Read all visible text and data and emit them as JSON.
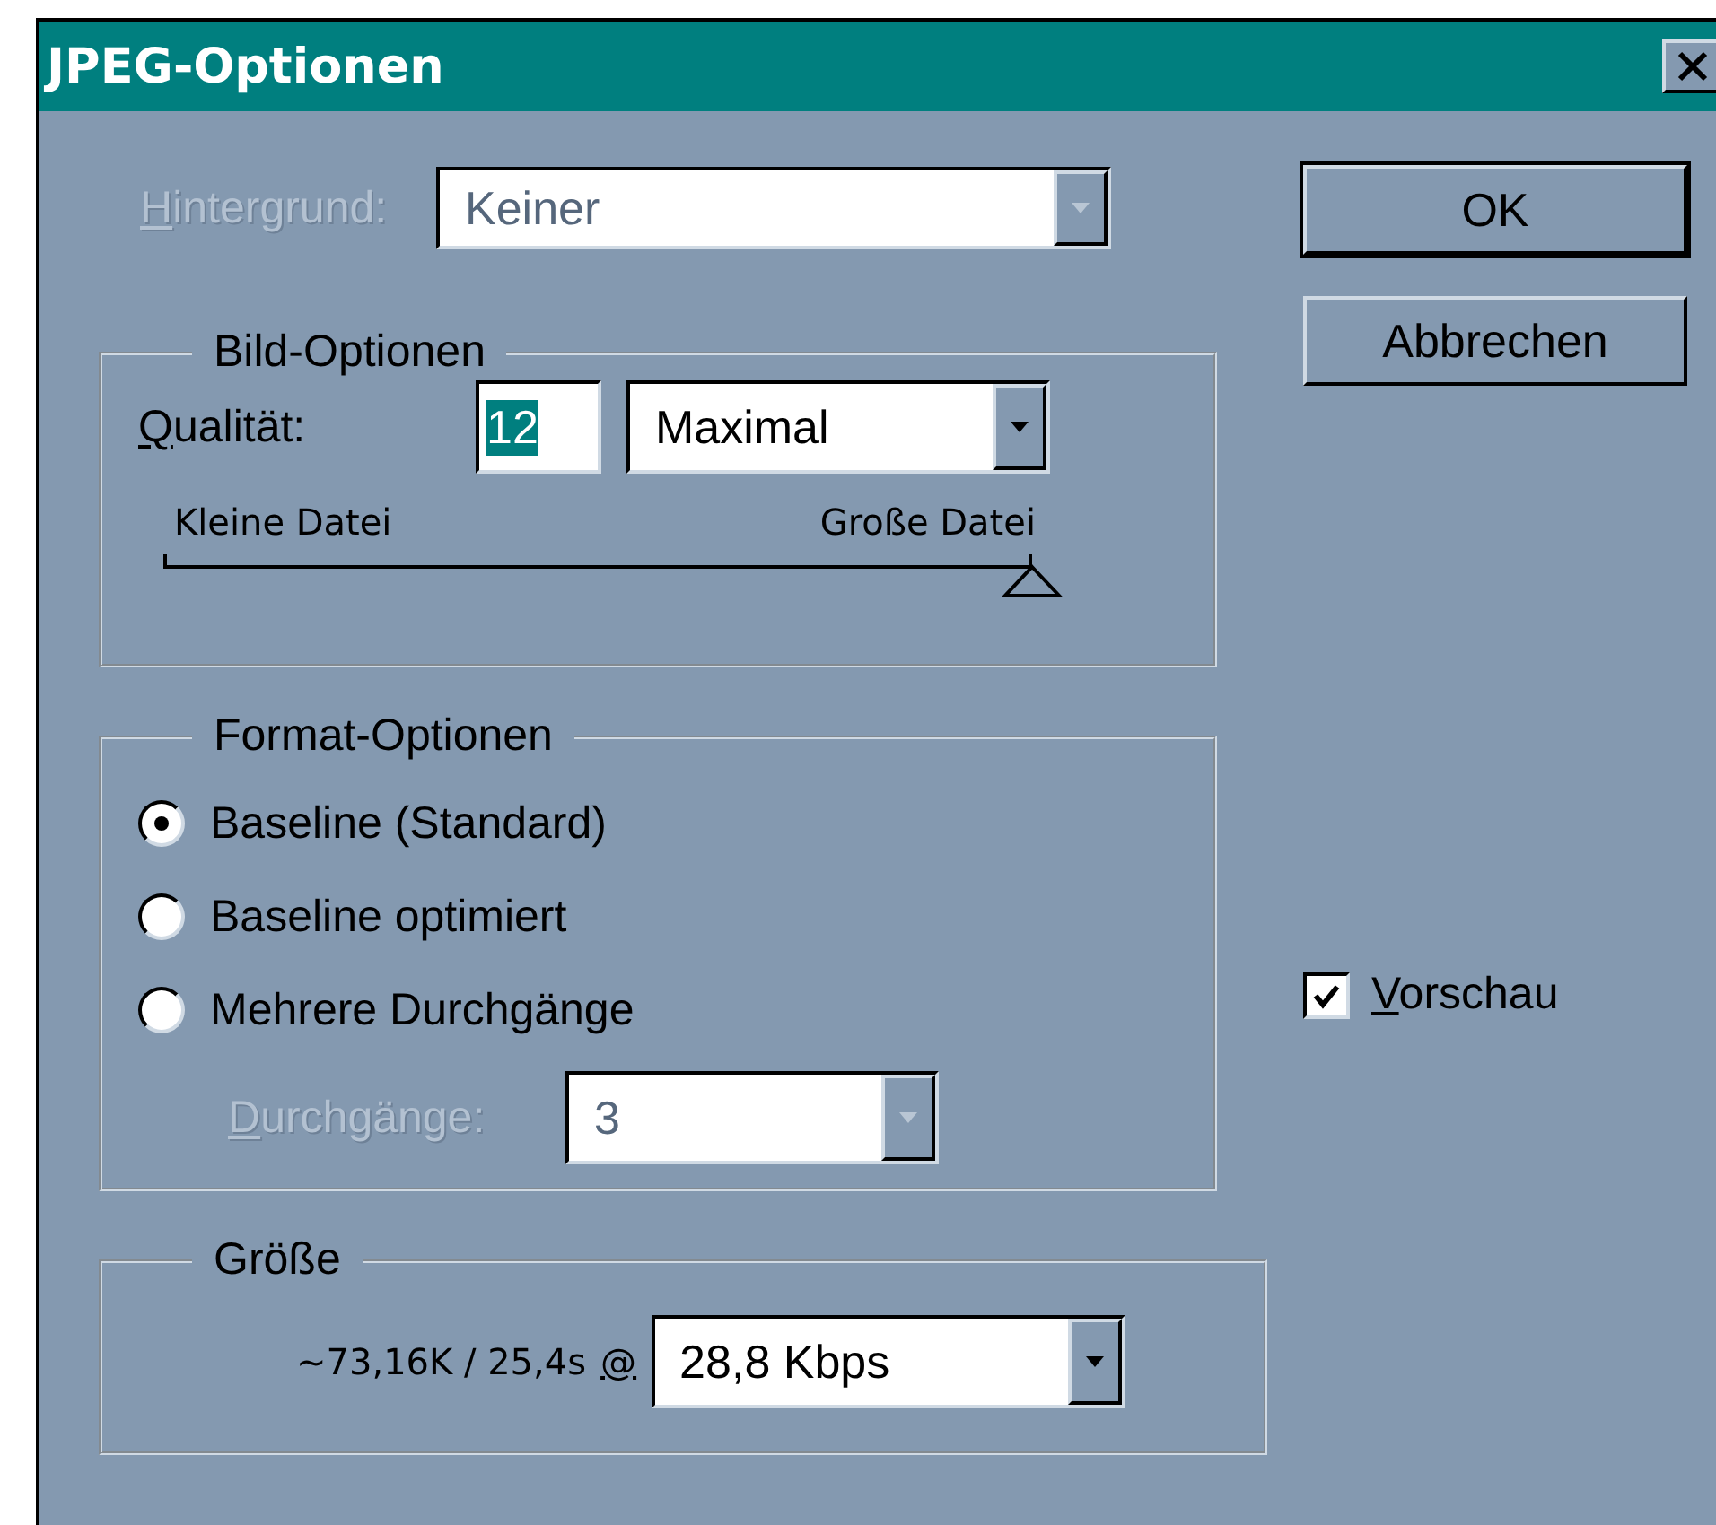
{
  "window": {
    "title": "JPEG-Optionen"
  },
  "background": {
    "label": "Hintergrund:",
    "value": "Keiner",
    "disabled": true
  },
  "buttons": [
    {
      "label": "OK",
      "default": true
    },
    {
      "label": "Abbrechen",
      "default": false
    }
  ],
  "image_options": {
    "title": "Bild-Optionen",
    "quality_label": "Qualität:",
    "quality_value": "12",
    "quality_value_selected": true,
    "quality_preset": "Maximal",
    "slider": {
      "min_label": "Kleine Datei",
      "max_label": "Große Datei",
      "level": 1
    }
  },
  "format_options": {
    "title": "Format-Optionen",
    "options": [
      {
        "label": "Baseline (Standard)",
        "selected": true
      },
      {
        "label": "Baseline optimiert",
        "selected": false
      },
      {
        "label": "Mehrere Durchgänge",
        "selected": false
      }
    ],
    "passes": {
      "label": "Durchgänge:",
      "value": "3",
      "disabled": true
    }
  },
  "size": {
    "title": "Größe",
    "estimate": "~73,16K / 25,4s",
    "at_label": "@",
    "speed": "28,8 Kbps"
  },
  "preview": {
    "label": "Vorschau",
    "checked": true
  }
}
